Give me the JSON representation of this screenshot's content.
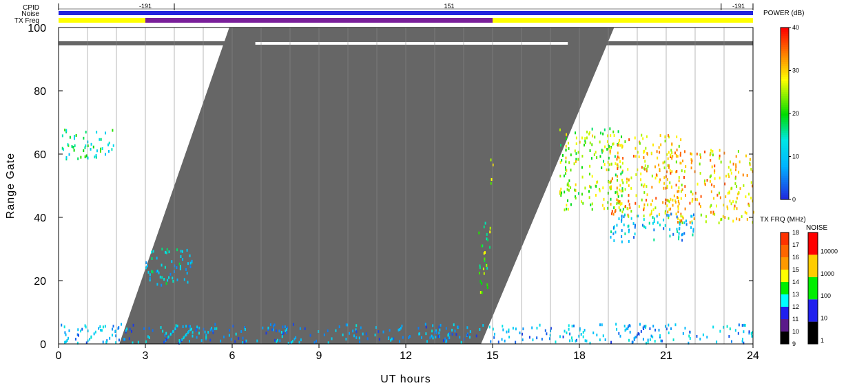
{
  "header": {
    "cpid_label": "CPID",
    "noise_label": "Noise",
    "txfreq_label": "TX Freq",
    "cpid_values": [
      {
        "t": 3.0,
        "label": "-191"
      },
      {
        "t": 13.5,
        "label": "151"
      },
      {
        "t": 23.5,
        "label": "-191"
      }
    ],
    "cpid_ticks": [
      0,
      4,
      22.9,
      24
    ],
    "txfreq_segments": [
      {
        "start": 0,
        "end": 3.0,
        "color": "#ffff00"
      },
      {
        "start": 3.0,
        "end": 15.0,
        "color": "#7a1f9a"
      },
      {
        "start": 15.0,
        "end": 24,
        "color": "#ffff00"
      }
    ],
    "noise_color": "#2222dd"
  },
  "chart_data": {
    "type": "heatmap",
    "xlabel": "UT hours",
    "ylabel": "Range Gate",
    "xlim": [
      0,
      24
    ],
    "ylim": [
      0,
      100
    ],
    "x_ticks": [
      0,
      3,
      6,
      9,
      12,
      15,
      18,
      21,
      24
    ],
    "y_ticks": [
      0,
      20,
      40,
      60,
      80,
      100
    ],
    "vertical_grid_hours": [
      1,
      2,
      3,
      4,
      5,
      6,
      7,
      8,
      9,
      10,
      11,
      12,
      13,
      14,
      15,
      16,
      17,
      18,
      19,
      20,
      21,
      22,
      23
    ],
    "masked_region": {
      "description_color": "#666666",
      "lower_edge_gate0_hour": 2.1,
      "lower_edge_gate100_hour": 5.9,
      "upper_edge_gate0_hour": 14.6,
      "upper_edge_gate100_hour": 19.2
    },
    "gate_95_bar": {
      "gate": 95,
      "color": "#666666",
      "white_start": 6.8,
      "white_end": 17.6
    },
    "scatter_blobs": [
      {
        "x0": 0.1,
        "x1": 1.9,
        "g0": 58,
        "g1": 68,
        "power": 16
      },
      {
        "x0": 3.0,
        "x1": 4.6,
        "g0": 18,
        "g1": 30,
        "power": 12
      },
      {
        "x0": 14.5,
        "x1": 14.9,
        "g0": 16,
        "g1": 40,
        "power": 22
      },
      {
        "x0": 14.9,
        "x1": 15.0,
        "g0": 46,
        "g1": 61,
        "power": 24
      },
      {
        "x0": 17.3,
        "x1": 19.5,
        "g0": 42,
        "g1": 68,
        "power": 24
      },
      {
        "x0": 19.0,
        "x1": 21.5,
        "g0": 40,
        "g1": 66,
        "power": 30
      },
      {
        "x0": 21.0,
        "x1": 24.0,
        "g0": 38,
        "g1": 61,
        "power": 30
      },
      {
        "x0": 19.0,
        "x1": 22.0,
        "g0": 32,
        "g1": 41,
        "power": 10
      },
      {
        "x0": 0.0,
        "x1": 24.0,
        "g0": 0,
        "g1": 6,
        "power": 8
      }
    ],
    "power_colorbar": {
      "label": "POWER (dB)",
      "range": [
        0,
        40
      ],
      "ticks": [
        0,
        10,
        20,
        30,
        40
      ]
    },
    "txfreq_colorbar": {
      "label": "TX FRQ (MHz)",
      "ticks": [
        9,
        10,
        11,
        12,
        13,
        14,
        15,
        16,
        17,
        18
      ],
      "colors": [
        "#000000",
        "#5a1a8a",
        "#2020ee",
        "#00ffff",
        "#00ee00",
        "#ffff00",
        "#ff9900",
        "#ff6600",
        "#ff3300"
      ]
    },
    "noise_colorbar": {
      "label": "NOISE",
      "ticks": [
        "1",
        "10",
        "100",
        "1000",
        "10000"
      ],
      "colors": [
        "#000000",
        "#2020ee",
        "#00ee00",
        "#ffcc00",
        "#ff0000"
      ]
    }
  }
}
